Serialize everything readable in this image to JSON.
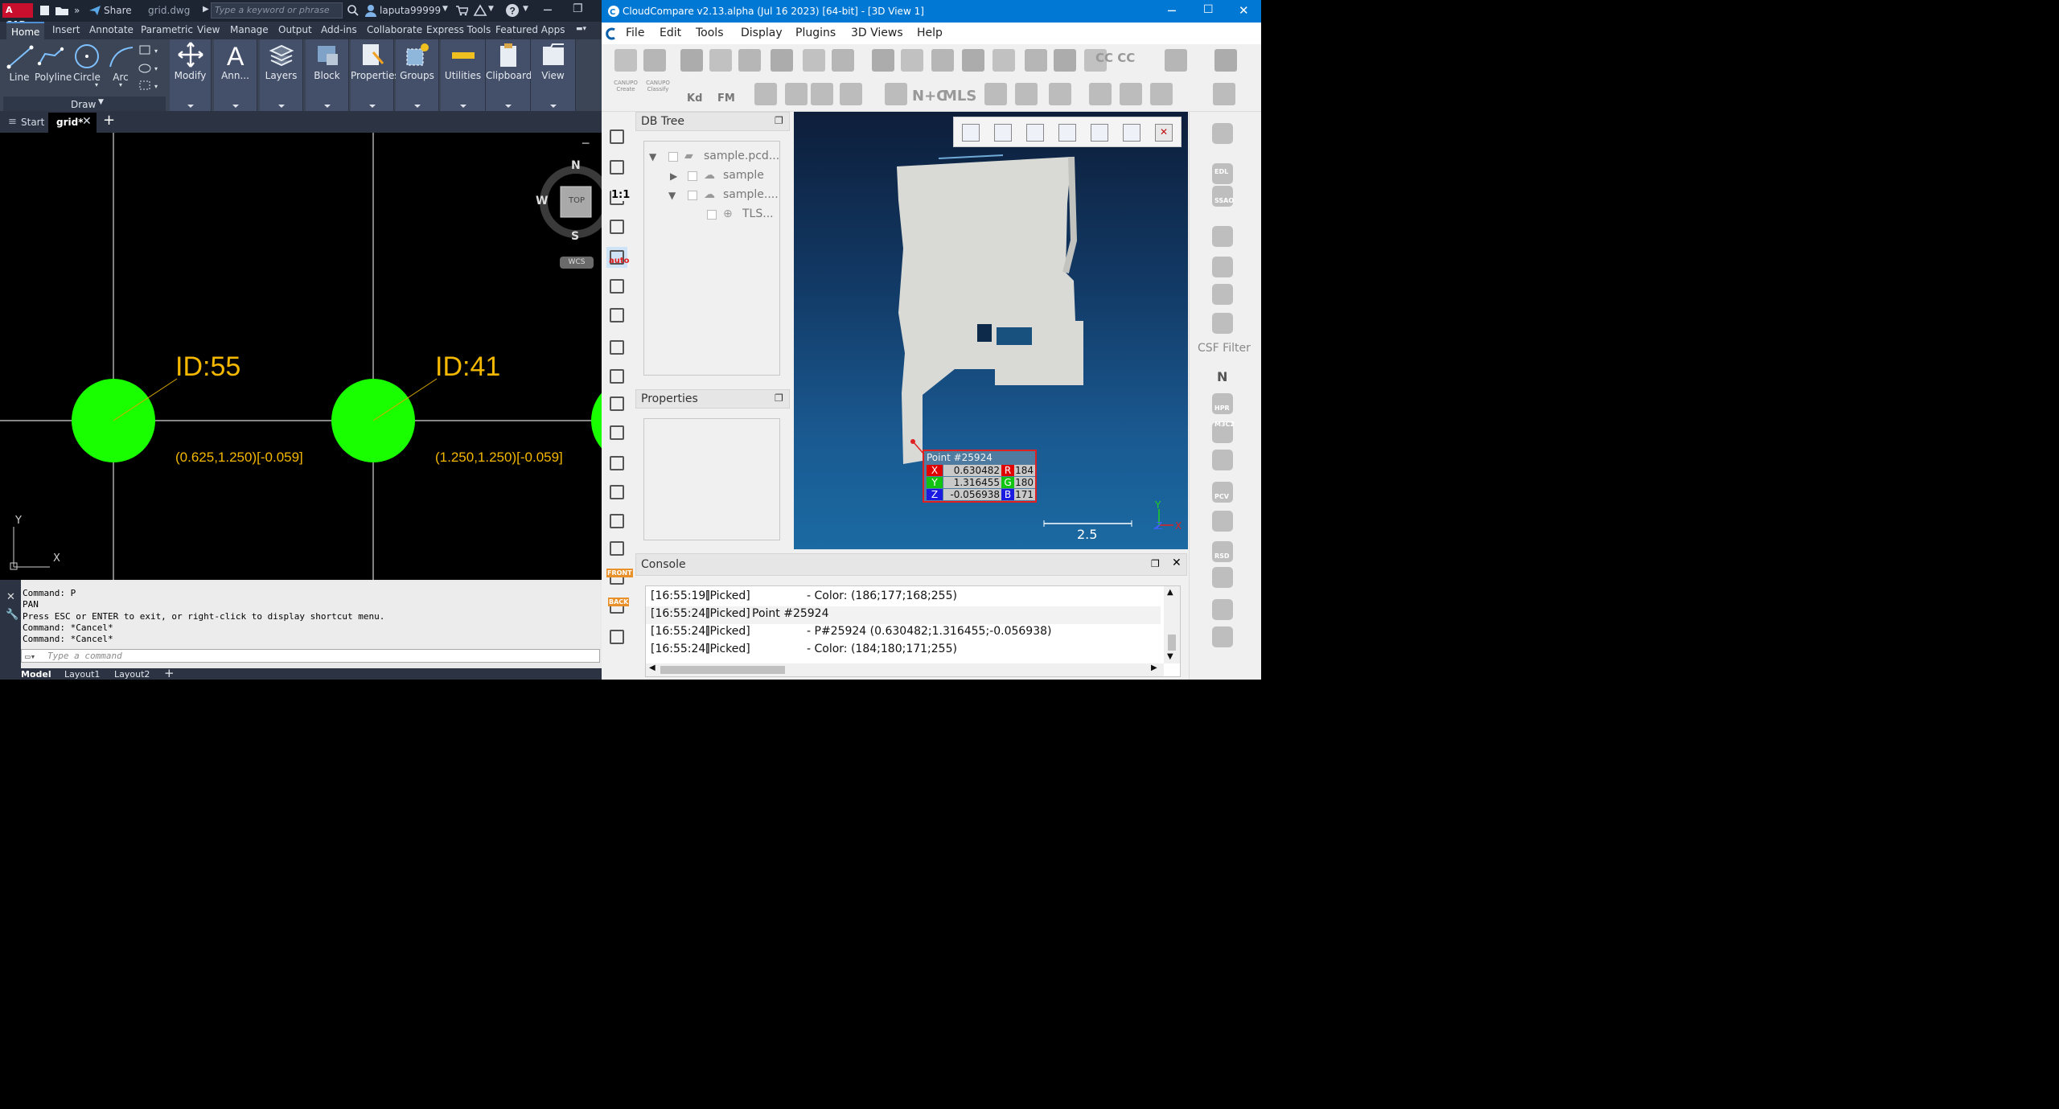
{
  "autocad": {
    "title_bar": {
      "logo": "A CAD",
      "share": "Share",
      "filename": "grid.dwg",
      "search_placeholder": "Type a keyword or phrase",
      "user": "laputa99999"
    },
    "ribbon_tabs": [
      "Home",
      "Insert",
      "Annotate",
      "Parametric",
      "View",
      "Manage",
      "Output",
      "Add-ins",
      "Collaborate",
      "Express Tools",
      "Featured Apps"
    ],
    "draw_tools": [
      "Line",
      "Polyline",
      "Circle",
      "Arc"
    ],
    "draw_panel_label": "Draw",
    "big_panels": [
      "Modify",
      "Ann...",
      "Layers",
      "Block",
      "Properties",
      "Groups",
      "Utilities",
      "Clipboard",
      "View"
    ],
    "doc_tabs": {
      "start": "Start",
      "active": "grid*",
      "add": "+"
    },
    "viewcube": {
      "north": "N",
      "south": "S",
      "west": "W",
      "face": "TOP",
      "wcs": "WCS"
    },
    "drawing": {
      "points": [
        {
          "id": "ID:55",
          "coords": "(0.625,1.250)[-0.059]"
        },
        {
          "id": "ID:41",
          "coords": "(1.250,1.250)[-0.059]"
        }
      ],
      "ucs_y": "Y",
      "ucs_x": "X",
      "colors": {
        "circle": "#19ff00",
        "label": "#f5b800",
        "grid": "#d6d6d6"
      }
    },
    "command_history": [
      "Command: P",
      "PAN",
      "Press ESC or ENTER to exit, or right-click to display shortcut menu.",
      "Command: *Cancel*",
      "Command: *Cancel*"
    ],
    "command_placeholder": "Type a command",
    "layout_tabs": [
      "Model",
      "Layout1",
      "Layout2",
      "+"
    ]
  },
  "cloudcompare": {
    "title": "CloudCompare v2.13.alpha (Jul 16 2023) [64-bit] - [3D View 1]",
    "menu": [
      "File",
      "Edit",
      "Tools",
      "Display",
      "Plugins",
      "3D Views",
      "Help"
    ],
    "toolbar2_labels": {
      "canupo_create": "CANUPO Create",
      "canupo_classify": "CANUPO Classify",
      "kd": "Kd",
      "fm": "FM",
      "ntc": "N+C",
      "mls": "MLS",
      "cc": "CC CC"
    },
    "left_tool_labels": {
      "one_to_one": "1:1",
      "auto": "auto",
      "front": "FRONT",
      "back": "BACK"
    },
    "db_tree": {
      "title": "DB Tree",
      "items": [
        {
          "label": "sample.pcd..."
        },
        {
          "label": "sample"
        },
        {
          "label": "sample...."
        },
        {
          "label": "TLS..."
        }
      ]
    },
    "properties_title": "Properties",
    "picked_point": {
      "title": "Point #25924",
      "x": "0.630482",
      "y": "1.316455",
      "z": "-0.056938",
      "r": "184",
      "g": "180",
      "b": "171",
      "labels": {
        "x": "X",
        "y": "Y",
        "z": "Z",
        "r": "R",
        "g": "G",
        "b": "B"
      }
    },
    "scale_value": "2.5",
    "axis_labels": {
      "y": "Y",
      "z": "Z",
      "x": "X"
    },
    "right_panel": {
      "csf_filter": "CSF Filter",
      "north": "N",
      "edl": "EDL",
      "ssao": "SSAO",
      "hpr": "HPR",
      "m3c2": "M3C2",
      "pcv": "PCV",
      "rsd": "RSD"
    },
    "console": {
      "title": "Console",
      "lines": [
        {
          "time": "[16:55:19]",
          "tag": "[Picked]",
          "msg": "- Color: (186;177;168;255)",
          "indent": true
        },
        {
          "time": "[16:55:24]",
          "tag": "[Picked]",
          "msg": "Point #25924",
          "indent": false
        },
        {
          "time": "[16:55:24]",
          "tag": "[Picked]",
          "msg": "- P#25924 (0.630482;1.316455;-0.056938)",
          "indent": true
        },
        {
          "time": "[16:55:24]",
          "tag": "[Picked]",
          "msg": "- Color: (184;180;171;255)",
          "indent": true
        }
      ]
    }
  }
}
